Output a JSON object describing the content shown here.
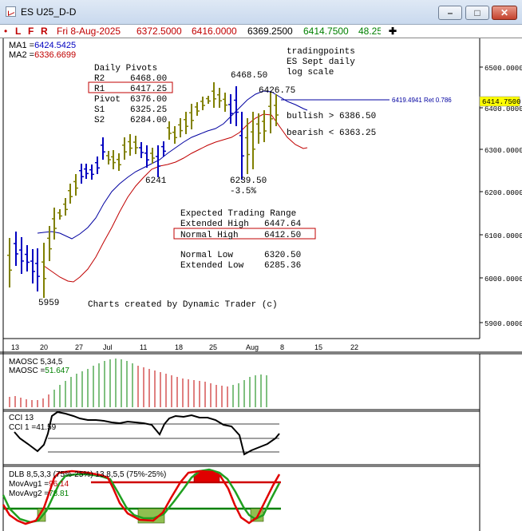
{
  "window": {
    "title": "ES U25_D-D",
    "minimize_glyph": "–",
    "maximize_glyph": "□",
    "close_glyph": "✕"
  },
  "toolbar": {
    "bullet": "•",
    "L": "L",
    "F": "F",
    "R": "R",
    "date": "Fri 8-Aug-2025",
    "open": "6372.5000",
    "high": "6416.0000",
    "low": "6369.2500",
    "close": "6414.7500",
    "change": "48.25",
    "crosshair": "✚"
  },
  "main_chart": {
    "ma1_label": "MA1 =",
    "ma1_value": "6424.5425",
    "ma2_label": "MA2 =",
    "ma2_value": "6336.6699",
    "note_1": "tradingpoints",
    "note_2": "ES Sept daily",
    "note_3": "log scale",
    "pivots_title": "Daily Pivots",
    "pivots": [
      {
        "label": "R2",
        "value": "6468.00"
      },
      {
        "label": "R1",
        "value": "6417.25"
      },
      {
        "label": "Pivot",
        "value": "6376.00"
      },
      {
        "label": "S1",
        "value": "6325.25"
      },
      {
        "label": "S2",
        "value": "6284.00"
      }
    ],
    "range_title": "Expected Trading Range",
    "ranges": [
      {
        "label": "Extended High",
        "value": "6447.64"
      },
      {
        "label": "Normal High",
        "value": "6412.50"
      },
      {
        "label": "Normal Low",
        "value": "6320.50"
      },
      {
        "label": "Extended Low",
        "value": "6285.36"
      }
    ],
    "bullish": "bullish > 6386.50",
    "bearish": "bearish < 6363.25",
    "hi_label_1": "6468.50",
    "hi_label_2": "6426.75",
    "lo_label_1": "6241",
    "lo_label_2": "6239.50",
    "lo_pct": "-3.5%",
    "lo_label_3": "5959",
    "retrace_text": "6419.4941 Ret 0.786",
    "credit": "Charts created by Dynamic Trader (c)",
    "last_price": "6414.7500",
    "price_axis": [
      "6500.0000",
      "6400.0000",
      "6300.0000",
      "6200.0000",
      "6100.0000",
      "6000.0000",
      "5900.0000"
    ],
    "date_axis": [
      "13",
      "20",
      "27",
      "Jul",
      "11",
      "18",
      "25",
      "Aug",
      "8",
      "15",
      "22"
    ]
  },
  "maosc_panel": {
    "title": "MAOSC 5,34,5",
    "value_label": "MAOSC =",
    "value": "51.647"
  },
  "cci_panel": {
    "title": "CCI 13",
    "value_label": "CCI 1  =",
    "value": "41.59"
  },
  "dlb_panel": {
    "title": "DLB 8,5,3,3 (75%-25%) 13,8,5,5 (75%-25%)",
    "mov1_label": "MovAvg1 =",
    "mov1_value": "96.14",
    "mov2_label": "MovAvg2 =",
    "mov2_value": "78.81"
  },
  "colors": {
    "olive_bar": "#808000",
    "blue_bar": "#0000c0",
    "ma_blue": "#0000a0",
    "ma_red": "#c00000",
    "toolbar_red": "#c00000",
    "toolbar_green": "#008000",
    "highlight_yellow": "#ffff00"
  }
}
